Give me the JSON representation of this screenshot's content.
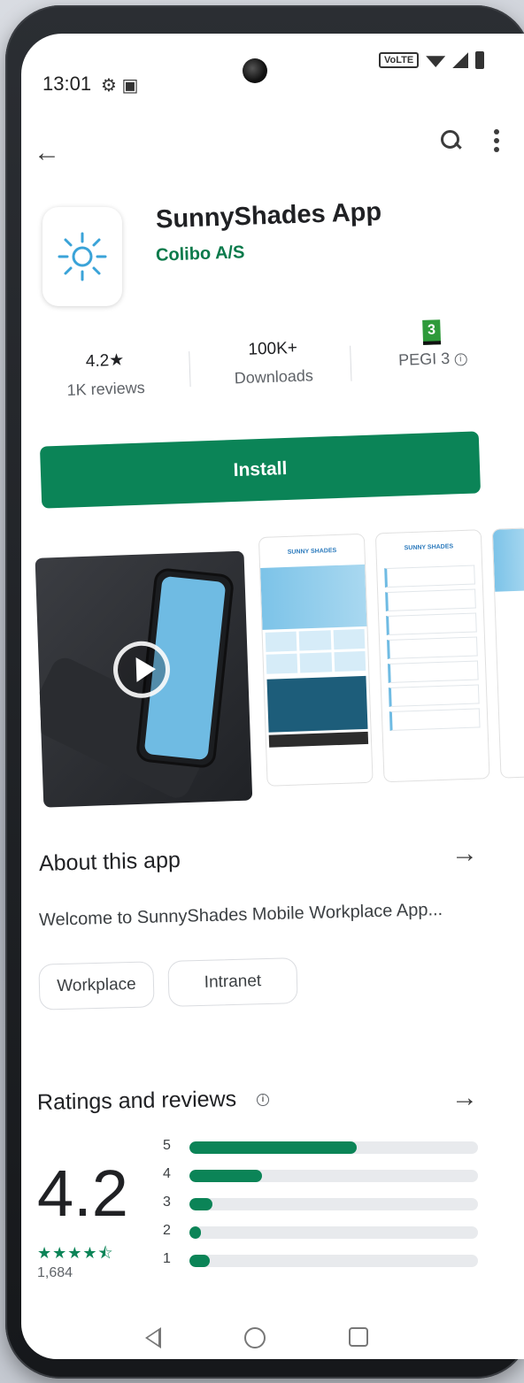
{
  "status_bar": {
    "time": "13:01",
    "network": "VoLTE"
  },
  "app": {
    "title": "SunnyShades App",
    "developer": "Colibo A/S"
  },
  "stats": {
    "rating": "4.2★",
    "reviews_label": "1K reviews",
    "downloads": "100K+",
    "downloads_label": "Downloads",
    "pegi_badge": "3",
    "pegi_label": "PEGI 3"
  },
  "install_label": "Install",
  "screenshots": {
    "shot2_brand": "SUNNY SHADES",
    "shot3_brand": "SUNNY SHADES"
  },
  "about": {
    "title": "About this app",
    "description": "Welcome to SunnyShades Mobile Workplace App...",
    "chips": [
      "Workplace",
      "Intranet"
    ]
  },
  "ratings": {
    "title": "Ratings and reviews",
    "average": "4.2",
    "stars": "★★★★⯪",
    "count": "1,684",
    "bars": [
      {
        "label": "5",
        "fraction": 0.58
      },
      {
        "label": "4",
        "fraction": 0.25
      },
      {
        "label": "3",
        "fraction": 0.08
      },
      {
        "label": "2",
        "fraction": 0.04
      },
      {
        "label": "1",
        "fraction": 0.07
      }
    ]
  },
  "colors": {
    "accent": "#0b8457",
    "brand_blue": "#3aa3d8"
  }
}
